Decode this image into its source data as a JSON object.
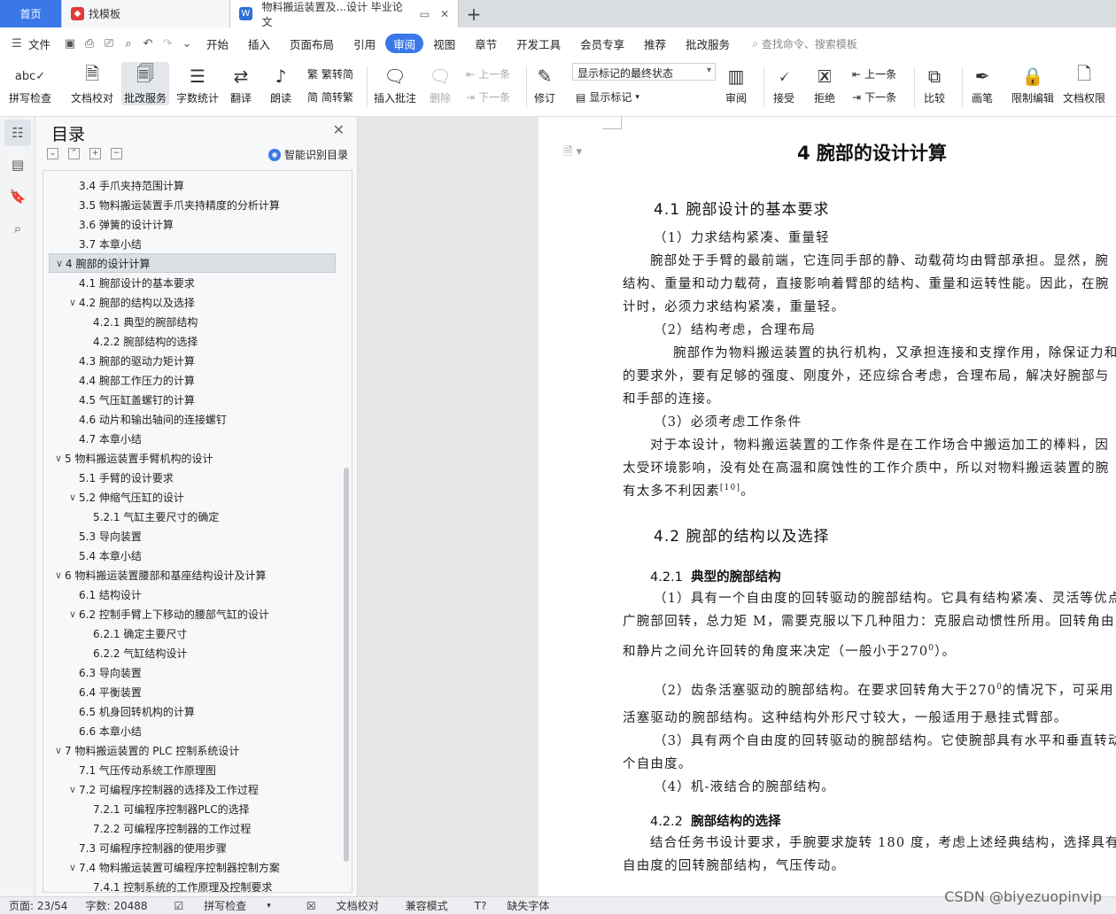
{
  "tabs": {
    "home": "首页",
    "tab2": "找模板",
    "tab3": "物料搬运装置及...设计 毕业论文"
  },
  "menubar": {
    "file": "文件",
    "items": [
      "开始",
      "插入",
      "页面布局",
      "引用",
      "审阅",
      "视图",
      "章节",
      "开发工具",
      "会员专享",
      "推荐",
      "批改服务"
    ],
    "search": "查找命令、搜索模板"
  },
  "ribbon": {
    "spell": "拼写检查",
    "proof": "文档校对",
    "correct": "批改服务",
    "count": "字数统计",
    "translate": "翻译",
    "read": "朗读",
    "trad": "繁转简",
    "simp": "简转繁",
    "insert_comment": "插入批注",
    "delete": "删除",
    "prev": "上一条",
    "next": "下一条",
    "revise": "修订",
    "markup_state": "显示标记的最终状态",
    "show_markup": "显示标记",
    "review": "审阅",
    "accept": "接受",
    "reject": "拒绝",
    "prev2": "上一条",
    "next2": "下一条",
    "compare": "比较",
    "pen": "画笔",
    "restrict": "限制编辑",
    "rights": "文档权限"
  },
  "toc": {
    "title": "目录",
    "smart": "智能识别目录",
    "items": [
      "3.4  手爪夹持范围计算",
      "3.5  物料搬运装置手爪夹持精度的分析计算",
      "3.6  弹簧的设计计算",
      "3.7  本章小结",
      "4  腕部的设计计算",
      "4.1  腕部设计的基本要求",
      "4.2  腕部的结构以及选择",
      "4.2.1  典型的腕部结构",
      "4.2.2  腕部结构的选择",
      "4.3  腕部的驱动力矩计算",
      "4.4  腕部工作压力的计算",
      "4.5  气压缸盖螺钉的计算",
      "4.6  动片和输出轴间的连接螺钉",
      "4.7  本章小结",
      "5  物料搬运装置手臂机构的设计",
      "5.1  手臂的设计要求",
      "5.2  伸缩气压缸的设计",
      "5.2.1  气缸主要尺寸的确定",
      "5.3  导向装置",
      "5.4  本章小结",
      "6  物料搬运装置腰部和基座结构设计及计算",
      "6.1  结构设计",
      "6.2  控制手臂上下移动的腰部气缸的设计",
      "6.2.1  确定主要尺寸",
      "6.2.2  气缸结构设计",
      "6.3  导向装置",
      "6.4  平衡装置",
      "6.5  机身回转机构的计算",
      "6.6  本章小结",
      "7  物料搬运装置的 PLC 控制系统设计",
      "7.1  气压传动系统工作原理图",
      "7.2  可编程序控制器的选择及工作过程",
      "7.2.1  可编程序控制器PLC的选择",
      "7.2.2  可编程序控制器的工作过程",
      "7.3  可编程序控制器的使用步骤",
      "7.4  物料搬运装置可编程序控制器控制方案",
      "7.4.1  控制系统的工作原理及控制要求"
    ]
  },
  "doc": {
    "h1": "4  腕部的设计计算",
    "h2a": "4.1  腕部设计的基本要求",
    "l1": "（1）力求结构紧凑、重量轻",
    "l2": "腕部处于手臂的最前端，它连同手部的静、动载荷均由臂部承担。显然，腕",
    "l3": "结构、重量和动力载荷，直接影响着臂部的结构、重量和运转性能。因此，在腕",
    "l4": "计时，必须力求结构紧凑，重量轻。",
    "l5": "（2）结构考虑，合理布局",
    "l6": "腕部作为物料搬运装置的执行机构，又承担连接和支撑作用，除保证力和",
    "l7": "的要求外，要有足够的强度、刚度外，还应综合考虑，合理布局，解决好腕部与",
    "l8": "和手部的连接。",
    "l9": "（3）必须考虑工作条件",
    "l10": "对于本设计，物料搬运装置的工作条件是在工作场合中搬运加工的棒料，因",
    "l11": "太受环境影响，没有处在高温和腐蚀性的工作介质中，所以对物料搬运装置的腕",
    "l12": "有太多不利因素",
    "l12sup": "[10]",
    "l12end": "。",
    "h2b": "4.2  腕部的结构以及选择",
    "h3a_num": "4.2.1",
    "h3a": "典型的腕部结构",
    "m1": "（1）具有一个自由度的回转驱动的腕部结构。它具有结构紧凑、灵活等优点",
    "m2": "广腕部回转，总力矩 M，需要克服以下几种阻力：克服启动惯性所用。回转角由",
    "m3": "和静片之间允许回转的角度来决定（一般小于270",
    "m3sup": "0",
    "m3end": "）。",
    "m4": "（2）齿条活塞驱动的腕部结构。在要求回转角大于270",
    "m4sup": "0",
    "m4end": "的情况下，可采用",
    "m5": "活塞驱动的腕部结构。这种结构外形尺寸较大，一般适用于悬挂式臂部。",
    "m6": "（3）具有两个自由度的回转驱动的腕部结构。它使腕部具有水平和垂直转动",
    "m7": "个自由度。",
    "m8": "（4）机-液结合的腕部结构。",
    "h3b_num": "4.2.2",
    "h3b": "腕部结构的选择",
    "n1": "结合任务书设计要求，手腕要求旋转 180 度，考虑上述经典结构，选择具有",
    "n2": "自由度的回转腕部结构，气压传动。"
  },
  "status": {
    "page": "页面: 23/54",
    "words": "字数: 20488",
    "spell": "拼写检查",
    "proof": "文档校对",
    "compat": "兼容模式",
    "missing_font": "缺失字体"
  },
  "watermark": "CSDN @biyezuopinvip"
}
